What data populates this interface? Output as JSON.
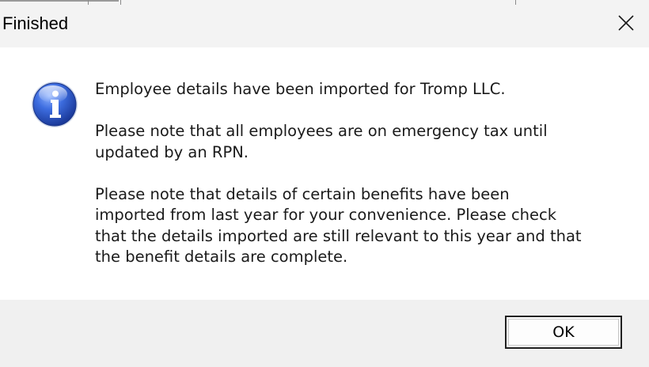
{
  "window": {
    "title": "Finished",
    "close_icon": "close-icon"
  },
  "dialog": {
    "icon": "information-icon",
    "message_paragraphs": [
      "Employee details have been imported for Tromp LLC.",
      "Please note that all employees are on emergency tax until\nupdated by an RPN.",
      "Please note that details of certain benefits have been\nimported from last year for your convenience. Please check\nthat the details imported are still relevant to this year and that\nthe benefit details are complete."
    ],
    "ok_label": "OK"
  },
  "colors": {
    "title_bar": "#f3f3f3",
    "content_background": "#ffffff",
    "footer_background": "#f0f0f0",
    "button_border": "#202020",
    "icon_blue": "#2a52be"
  }
}
